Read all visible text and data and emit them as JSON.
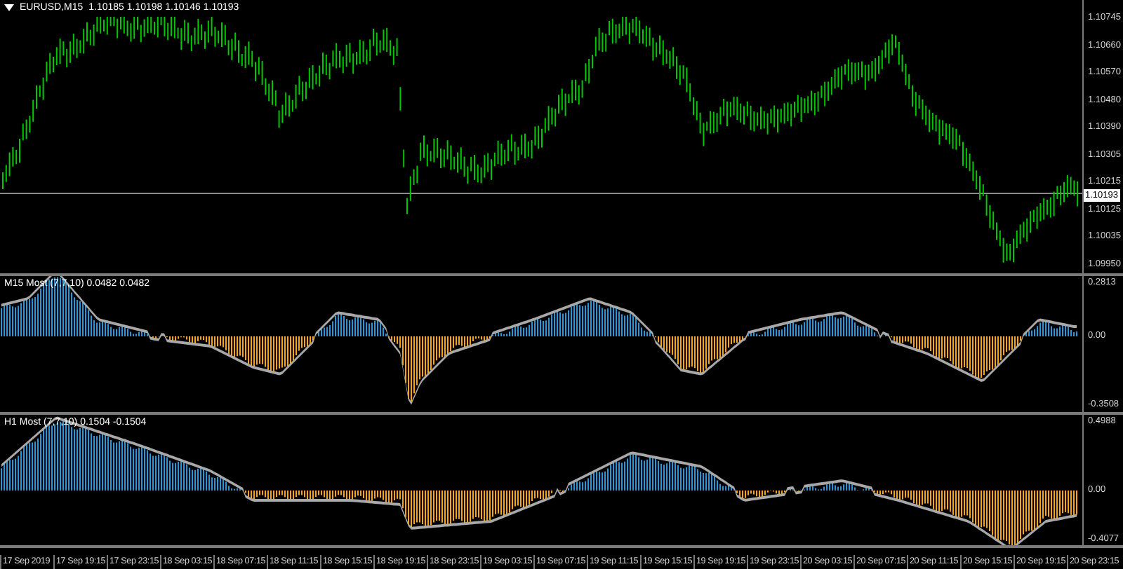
{
  "chart": {
    "title": "EURUSD,M15",
    "quote": "1.10185 1.10198 1.10146 1.10193",
    "price_axis": [
      "1.10745",
      "1.10660",
      "1.10570",
      "1.10480",
      "1.10390",
      "1.10305",
      "1.10215",
      "1.10125",
      "1.10035",
      "1.09950"
    ],
    "current_price": "1.10193"
  },
  "indicators": [
    {
      "label": "M15 Most (7,7,10) 0.0482 0.0482",
      "axis": [
        "0.2813",
        "0.00",
        "-0.3508"
      ]
    },
    {
      "label": "H1 Most (7,7,10) 0.1504 -0.1504",
      "axis": [
        "0.4988",
        "0.00",
        "-0.4077"
      ]
    }
  ],
  "time_axis": [
    "17 Sep 2019",
    "17 Sep 19:15",
    "17 Sep 23:15",
    "18 Sep 03:15",
    "18 Sep 07:15",
    "18 Sep 11:15",
    "18 Sep 15:15",
    "18 Sep 19:15",
    "18 Sep 23:15",
    "19 Sep 03:15",
    "19 Sep 07:15",
    "19 Sep 11:15",
    "19 Sep 15:15",
    "19 Sep 19:15",
    "19 Sep 23:15",
    "20 Sep 03:15",
    "20 Sep 07:15",
    "20 Sep 11:15",
    "20 Sep 15:15",
    "20 Sep 19:15",
    "20 Sep 23:15"
  ]
}
